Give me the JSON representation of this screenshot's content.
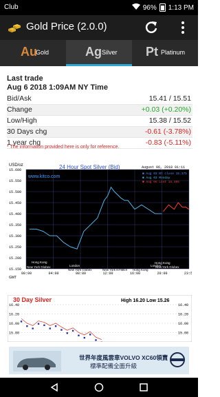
{
  "status": {
    "carrier": "Club",
    "battery": "96%",
    "time": "1:13 PM"
  },
  "app": {
    "title": "Gold Price (2.0.0)"
  },
  "tabs": [
    {
      "symbol": "Au",
      "name": "Gold"
    },
    {
      "symbol": "Ag",
      "name": "Silver"
    },
    {
      "symbol": "Pt",
      "name": "Platinum"
    }
  ],
  "trade": {
    "heading": "Last trade",
    "datetime": "Aug  6 2018  1:09AM NY Time"
  },
  "rows": [
    {
      "label": "Bid/Ask",
      "value": "15.41 / 15.51"
    },
    {
      "label": "Change",
      "value": "+0.03 (+0.20%)"
    },
    {
      "label": "Low/High",
      "value": "15.38 / 15.52"
    },
    {
      "label": "30 Days chg",
      "value": "-0.61 (-3.78%)"
    },
    {
      "label": "1 year chg",
      "value": "-0.83 (-5.11%)"
    }
  ],
  "disclaimer": "* The information provided here is only for reference.",
  "spot_chart": {
    "title": "24 Hour Spot Silver (Bid)",
    "unit": "USD/oz",
    "site": "www.kitco.com",
    "date": "August 06, 2018 01:11",
    "legend": [
      "■ Aug 03 NY close 15.375",
      "■ Aug 03 Monday",
      "■ Aug 06 Last 15.405"
    ],
    "markets": [
      "Hong Kong",
      "London",
      "New York Globex",
      "Hong Kong",
      "New York Globex",
      "New York NYMEX",
      "Hong Kong",
      "London",
      "New York Globex"
    ],
    "bottom_left": "GMT",
    "colors": {
      "bg": "#000000",
      "grid": "#2f3a73",
      "line_blue": "#4fb3e6",
      "line_red": "#ff3a2e",
      "axis_bg": "#ffffff"
    }
  },
  "chart_data": [
    {
      "type": "line",
      "title": "24 Hour Spot Silver (Bid)",
      "ylabel": "USD/oz",
      "ylim": [
        15.15,
        15.6
      ],
      "yticks": [
        "15.600",
        "15.550",
        "15.500",
        "15.450",
        "15.400",
        "15.350",
        "15.300",
        "15.250",
        "15.200",
        "15.150"
      ],
      "xticks": [
        "00:00",
        "04:00",
        "08:00",
        "12:00",
        "16:00",
        "20:00",
        "23:59"
      ],
      "series": [
        {
          "name": "Aug 03 Monday",
          "x": [
            0.5,
            1.5,
            2.5,
            3.5,
            4.5,
            5.5,
            6.5,
            7.5,
            8.0,
            8.5,
            9.5,
            10.5,
            11.0,
            11.5,
            12.0,
            12.5,
            13.0,
            14.0,
            14.5,
            15.0,
            16.0,
            17.0,
            18.0,
            19.0,
            20.0
          ],
          "y": [
            15.33,
            15.33,
            15.32,
            15.3,
            15.3,
            15.27,
            15.25,
            15.24,
            15.28,
            15.32,
            15.35,
            15.38,
            15.42,
            15.46,
            15.48,
            15.52,
            15.5,
            15.47,
            15.46,
            15.46,
            15.42,
            15.44,
            15.42,
            15.4,
            15.4
          ]
        },
        {
          "name": "Aug 06 Last 15.405",
          "x": [
            20.2,
            21.0,
            21.8,
            22.4,
            23.0,
            23.5,
            23.99
          ],
          "y": [
            15.41,
            15.44,
            15.42,
            15.45,
            15.43,
            15.43,
            15.42
          ]
        }
      ]
    },
    {
      "type": "line",
      "title": "30 Day Silver",
      "subtitle": "High 16.20 Low 15.26",
      "ylim": [
        15.6,
        16.4
      ],
      "yticks": [
        "16.40",
        "16.20",
        "16.00",
        "15.80"
      ],
      "series": [
        {
          "name": "price",
          "x": [
            1,
            2,
            3,
            4,
            5,
            6,
            7,
            8,
            9,
            10,
            11,
            12,
            13,
            14,
            15
          ],
          "y": [
            16.1,
            16.0,
            15.95,
            16.05,
            16.02,
            15.95,
            16.0,
            15.92,
            15.85,
            15.9,
            15.8,
            15.75,
            15.82,
            15.7,
            15.65
          ]
        }
      ]
    }
  ],
  "month_chart": {
    "title": "30 Day Silver",
    "stats": "High 16.20 Low 15.26"
  },
  "ad": {
    "text_line1": "世界年度風雲車VOLVO XC60領賣",
    "text_line2": "標準配備全面升級",
    "brand": "VOLVO"
  }
}
